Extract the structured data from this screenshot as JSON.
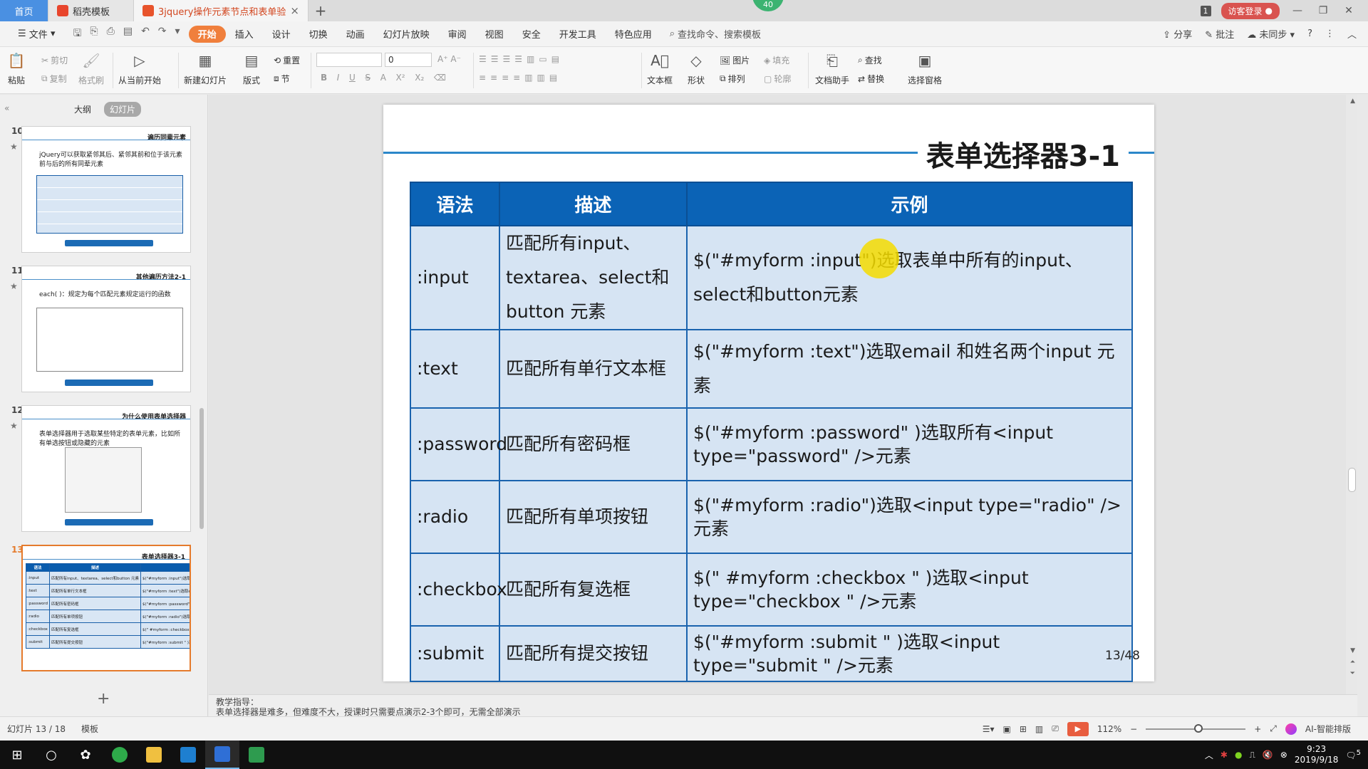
{
  "tabs": {
    "home": "首页",
    "daoke": "稻壳模板",
    "doc": "3jquery操作元素节点和表单验证",
    "tab_count": "1",
    "login": "访客登录"
  },
  "green_badge": "40",
  "menu": {
    "file": "文件",
    "items": [
      "开始",
      "插入",
      "设计",
      "切换",
      "动画",
      "幻灯片放映",
      "审阅",
      "视图",
      "安全",
      "开发工具",
      "特色应用"
    ],
    "search": "查找命令、搜索模板",
    "share": "分享",
    "comment": "批注",
    "sync": "未同步"
  },
  "ribbon": {
    "paste": "粘贴",
    "cut": "剪切",
    "copy": "复制",
    "format_painter": "格式刷",
    "from_current": "从当前开始",
    "new_slide": "新建幻灯片",
    "layout": "版式",
    "reset": "重置",
    "section": "节",
    "font_size": "0",
    "textbox": "文本框",
    "shape": "形状",
    "picture": "图片",
    "fill": "填充",
    "arrange": "排列",
    "outline": "轮廓",
    "doc_assistant": "文档助手",
    "find": "查找",
    "replace": "替换",
    "select_pane": "选择窗格"
  },
  "pane": {
    "outline_tab": "大纲",
    "slides_tab": "幻灯片",
    "thumbs": [
      {
        "num": "10",
        "title": "遍历同辈元素",
        "text": "jQuery可以获取紧邻其后、紧邻其前和位于该元素前与后的所有同辈元素"
      },
      {
        "num": "11",
        "title": "其他遍历方法2-1",
        "text": "each( )：规定为每个匹配元素规定运行的函数"
      },
      {
        "num": "12",
        "title": "为什么使用表单选择器",
        "text": "表单选择器用于选取某些特定的表单元素，比如所有单选按钮或隐藏的元素"
      },
      {
        "num": "13",
        "title": "表单选择器3-1",
        "text": ""
      }
    ]
  },
  "slide": {
    "title": "表单选择器3-1",
    "headers": [
      "语法",
      "描述",
      "示例"
    ],
    "rows": [
      {
        "syntax": ":input",
        "desc": "匹配所有input、textarea、select和button 元素",
        "example": "$(\"#myform  :input\")选取表单中所有的input、select和button元素"
      },
      {
        "syntax": ":text",
        "desc": "匹配所有单行文本框",
        "example": "$(\"#myform  :text\")选取email 和姓名两个input 元素"
      },
      {
        "syntax": ":password",
        "desc": "匹配所有密码框",
        "example": "$(\"#myform  :password\" )选取所有<input type=\"password\" />元素"
      },
      {
        "syntax": ":radio",
        "desc": "匹配所有单项按钮",
        "example": "$(\"#myform  :radio\")选取<input type=\"radio\" />元素"
      },
      {
        "syntax": ":checkbox",
        "desc": "匹配所有复选框",
        "example": "$(\" #myform  :checkbox \" )选取<input type=\"checkbox \" />元素"
      },
      {
        "syntax": ":submit",
        "desc": "匹配所有提交按钮",
        "example": "$(\"#myform  :submit \" )选取<input type=\"submit \" />元素"
      }
    ],
    "page": "13/48"
  },
  "notes": {
    "label": "教学指导：",
    "text": "表单选择器是难多，但难度不大，授课时只需要点演示2-3个即可，无需全部演示"
  },
  "status": {
    "slide_pos": "幻灯片 13 / 18",
    "template": "模板",
    "zoom": "112%",
    "ai": "AI-智能排版"
  },
  "taskbar": {
    "time": "9:23",
    "date": "2019/9/18",
    "notif": "5"
  }
}
